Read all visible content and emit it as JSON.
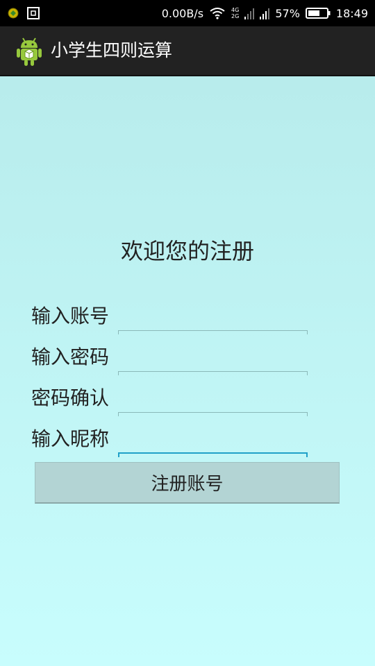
{
  "status_bar": {
    "network_speed": "0.00B/s",
    "network_type_top": "4G",
    "network_type_bottom": "2G",
    "battery_percent": "57%",
    "time": "18:49"
  },
  "app_bar": {
    "title": "小学生四则运算"
  },
  "form": {
    "heading": "欢迎您的注册",
    "fields": [
      {
        "label": "输入账号",
        "value": ""
      },
      {
        "label": "输入密码",
        "value": ""
      },
      {
        "label": "密码确认",
        "value": ""
      },
      {
        "label": "输入昵称",
        "value": ""
      }
    ],
    "submit_label": "注册账号"
  },
  "colors": {
    "status_bar_bg": "#000000",
    "app_bar_bg": "#222222",
    "content_bg_top": "#b8ecec",
    "content_bg_bottom": "#c8fdfd",
    "field_focus": "#1fa0c8",
    "button_bg": "#b3d4d4"
  }
}
